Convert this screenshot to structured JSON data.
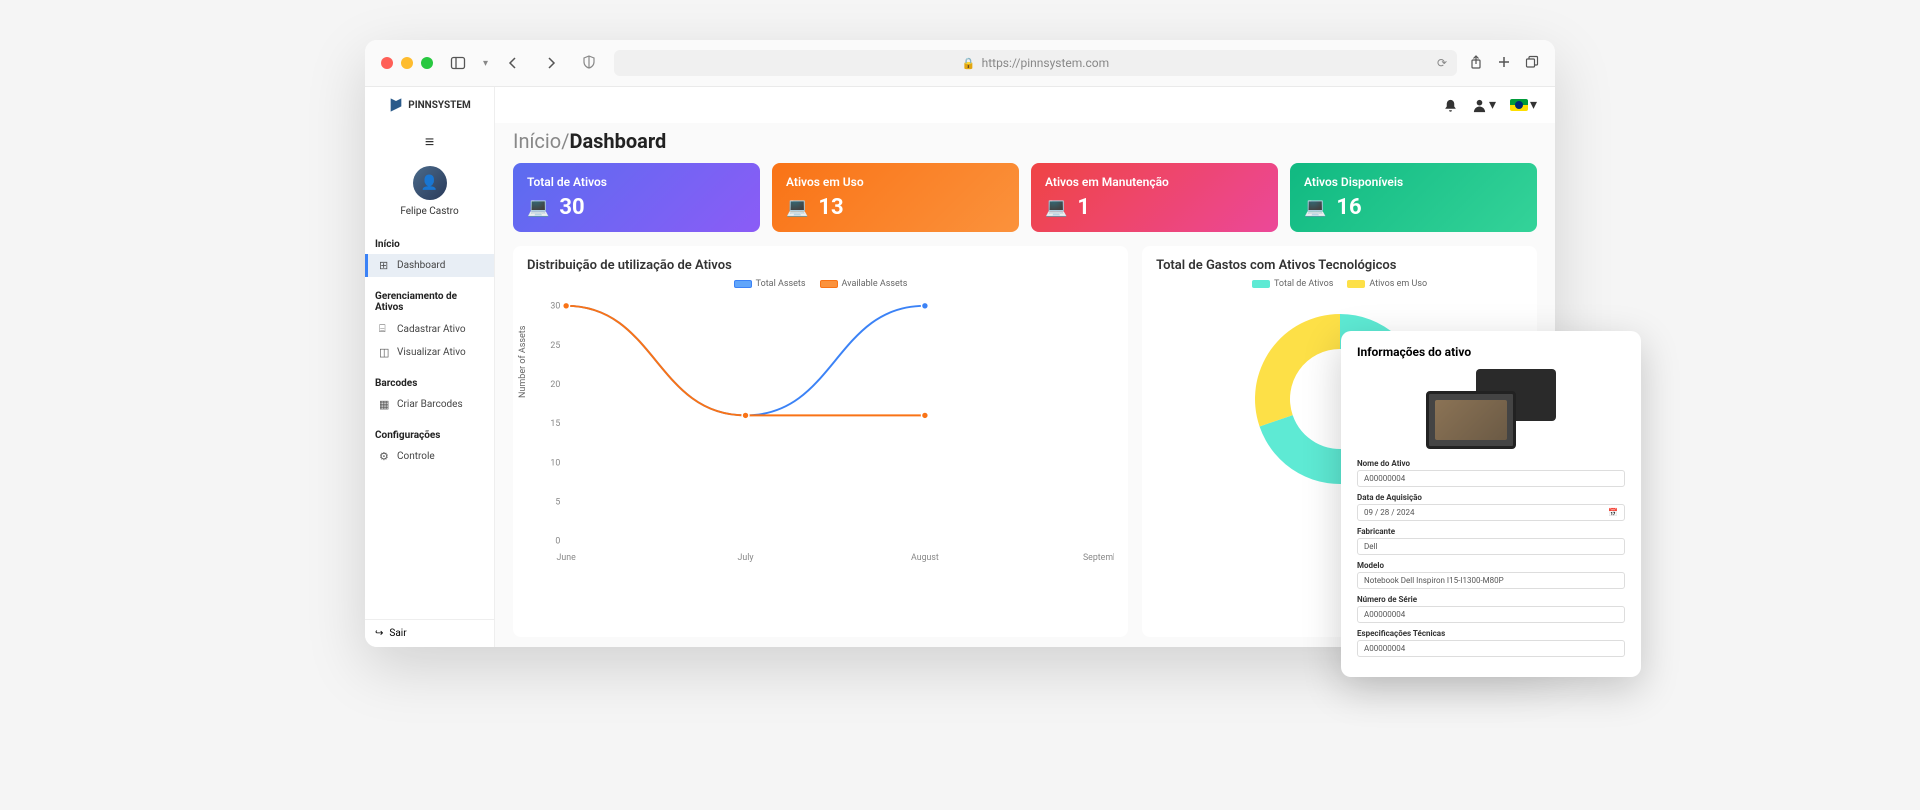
{
  "browser": {
    "url": "https://pinnsystem.com"
  },
  "logo": "PINNSYSTEM",
  "user": "Felipe Castro",
  "sidebar": {
    "sections": [
      {
        "header": "Início",
        "items": [
          {
            "icon": "⊞",
            "label": "Dashboard",
            "active": true
          }
        ]
      },
      {
        "header": "Gerenciamento de Ativos",
        "items": [
          {
            "icon": "⌸",
            "label": "Cadastrar Ativo"
          },
          {
            "icon": "◫",
            "label": "Visualizar Ativo"
          }
        ]
      },
      {
        "header": "Barcodes",
        "items": [
          {
            "icon": "▦",
            "label": "Criar Barcodes"
          }
        ]
      },
      {
        "header": "Configurações",
        "items": [
          {
            "icon": "⚙",
            "label": "Controle"
          }
        ]
      }
    ],
    "logout": "Sair"
  },
  "breadcrumb": {
    "root": "Início",
    "sep": "/",
    "current": "Dashboard"
  },
  "cards": [
    {
      "title": "Total de Ativos",
      "value": "30"
    },
    {
      "title": "Ativos em Uso",
      "value": "13"
    },
    {
      "title": "Ativos em Manutenção",
      "value": "1"
    },
    {
      "title": "Ativos Disponíveis",
      "value": "16"
    }
  ],
  "charts": {
    "line": {
      "title": "Distribuição de utilização de Ativos",
      "legend": [
        "Total Assets",
        "Available Assets"
      ],
      "ylabel": "Number of Assets"
    },
    "donut": {
      "title": "Total de Gastos com Ativos Tecnológicos",
      "legend": [
        "Total de Ativos",
        "Ativos em Uso"
      ]
    }
  },
  "chart_data": {
    "line": {
      "type": "line",
      "categories": [
        "June",
        "July",
        "August",
        "September"
      ],
      "series": [
        {
          "name": "Total Assets",
          "values": [
            30,
            16,
            30,
            null
          ]
        },
        {
          "name": "Available Assets",
          "values": [
            30,
            16,
            16,
            null
          ]
        }
      ],
      "ylabel": "Number of Assets",
      "ylim": [
        0,
        30
      ],
      "yticks": [
        0,
        5,
        10,
        15,
        20,
        25,
        30
      ]
    },
    "donut": {
      "type": "pie",
      "series": [
        {
          "name": "Total de Ativos",
          "value": 30,
          "color": "#5eead4"
        },
        {
          "name": "Ativos em Uso",
          "value": 13,
          "color": "#fde047"
        }
      ]
    }
  },
  "detail": {
    "title": "Informações do ativo",
    "fields": {
      "nome": {
        "label": "Nome do Ativo",
        "value": "A00000004"
      },
      "data": {
        "label": "Data de Aquisição",
        "value": "09 / 28 / 2024"
      },
      "fabricante": {
        "label": "Fabricante",
        "value": "Dell"
      },
      "modelo": {
        "label": "Modelo",
        "value": "Notebook Dell Inspiron I15-I1300-M80P"
      },
      "serie": {
        "label": "Número de Série",
        "value": "A00000004"
      },
      "spec": {
        "label": "Especificações Técnicas",
        "value": "A00000004"
      }
    }
  }
}
